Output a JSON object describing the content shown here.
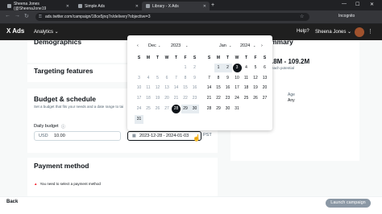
{
  "browser": {
    "tabs": [
      {
        "title": "Sheena Jones (@SheenaJone19"
      },
      {
        "title": "Simple Ads"
      },
      {
        "title": "Library - X Ads"
      }
    ],
    "url": "ads.twitter.com/campaign/18ce5jnq7n/delivery?objective=3",
    "profile": "Incognito"
  },
  "app": {
    "logo": "X Ads",
    "menu": "Analytics ⌄",
    "help": "Help?",
    "account": "Sheena Jones ⌄"
  },
  "form": {
    "demographics": "Demographics",
    "targeting": "Targeting features",
    "budget_title": "Budget & schedule",
    "budget_hint": "Set a budget that fits your needs and a date range to tai",
    "daily_budget_label": "Daily budget",
    "currency": "USD",
    "daily_budget_value": "10.00",
    "date_range": "2023-12-28 - 2024-01-03",
    "timezone": "PST",
    "payment_title": "Payment method",
    "payment_warning": "You need to select a payment method"
  },
  "summary": {
    "title": "mmary",
    "reach": ".8M - 109.2M",
    "reach_label": "each potential",
    "age_label": "Age",
    "age_value": "Any"
  },
  "calendar": {
    "left_month": "Dec",
    "left_year": "2023",
    "right_month": "Jan",
    "right_year": "2024",
    "weekdays": [
      "S",
      "M",
      "T",
      "W",
      "T",
      "F",
      "S"
    ],
    "left_days": [
      [
        "",
        "",
        "",
        "",
        "",
        "1",
        "2"
      ],
      [
        "3",
        "4",
        "5",
        "6",
        "7",
        "8",
        "9"
      ],
      [
        "10",
        "11",
        "12",
        "13",
        "14",
        "15",
        "16"
      ],
      [
        "17",
        "18",
        "19",
        "20",
        "21",
        "22",
        "23"
      ],
      [
        "24",
        "25",
        "26",
        "27",
        "28",
        "29",
        "30"
      ],
      [
        "31",
        "",
        "",
        "",
        "",
        "",
        ""
      ]
    ],
    "right_days": [
      [
        "",
        "1",
        "2",
        "3",
        "4",
        "5",
        "6"
      ],
      [
        "7",
        "8",
        "9",
        "10",
        "11",
        "12",
        "13"
      ],
      [
        "14",
        "15",
        "16",
        "17",
        "18",
        "19",
        "20"
      ],
      [
        "21",
        "22",
        "23",
        "24",
        "25",
        "26",
        "27"
      ],
      [
        "28",
        "29",
        "30",
        "31",
        "",
        "",
        ""
      ]
    ]
  },
  "footer": {
    "back": "Back",
    "launch": "Launch campaign"
  }
}
